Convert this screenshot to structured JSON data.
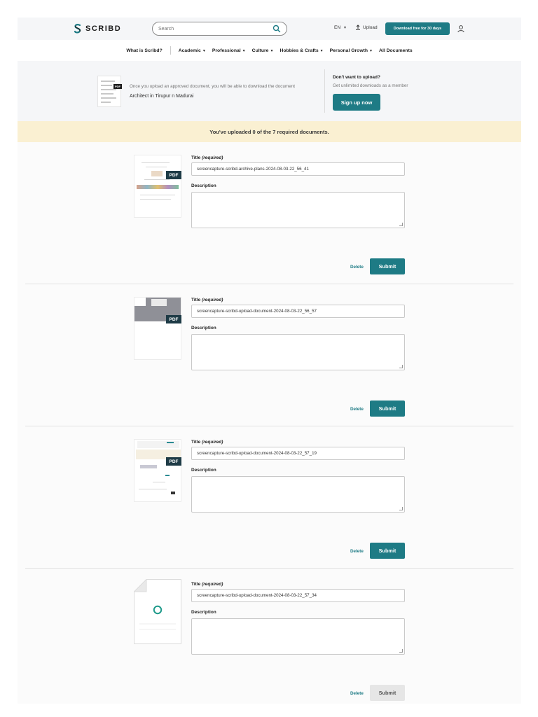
{
  "header": {
    "logo_text": "SCRIBD",
    "search_placeholder": "Search",
    "lang": "EN",
    "upload": "Upload",
    "download_button": "Download free for 30 days",
    "brand_color": "#1e7b85"
  },
  "nav": {
    "items": [
      "What is Scribd?",
      "Academic",
      "Professional",
      "Culture",
      "Hobbies & Crafts",
      "Personal Growth",
      "All Documents"
    ]
  },
  "promo": {
    "text": "Once you upload an approved document, you will be able to download the document",
    "doc_title": "Architect in Tirupur n Madurai",
    "pdf_badge": "PDF",
    "right_title": "Don't want to upload?",
    "right_sub": "Get unlimited downloads as a member",
    "signup_button": "Sign up now"
  },
  "warning": "You've uploaded 0 of the 7 required documents.",
  "form_labels": {
    "title": "Title",
    "title_required": "(required)",
    "description": "Description",
    "delete": "Delete",
    "submit": "Submit",
    "pdf": "PDF"
  },
  "documents": [
    {
      "title": "screencapture-scribd-archive-plans-2024-08-03-22_56_41",
      "submit_enabled": true
    },
    {
      "title": "screencapture-scribd-upload-document-2024-08-03-22_56_57",
      "submit_enabled": true
    },
    {
      "title": "screencapture-scribd-upload-document-2024-08-03-22_57_19",
      "submit_enabled": true
    },
    {
      "title": "screencapture-scribd-upload-document-2024-08-03-22_57_34",
      "submit_enabled": false
    }
  ]
}
